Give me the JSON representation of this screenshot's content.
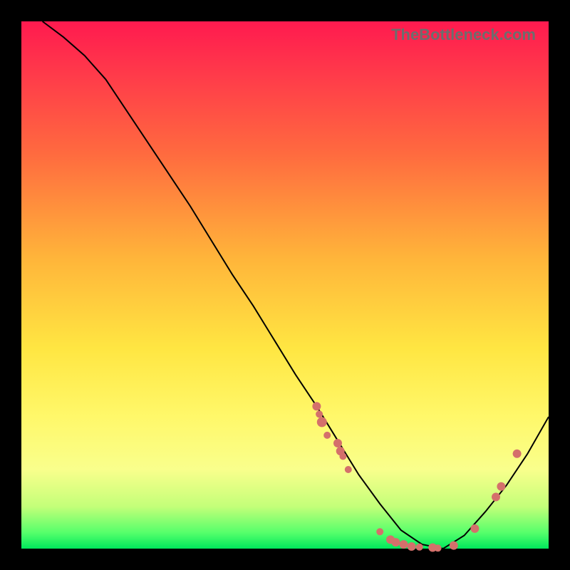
{
  "watermark": "TheBottleneck.com",
  "chart_data": {
    "type": "line",
    "title": "",
    "xlabel": "",
    "ylabel": "",
    "xlim": [
      0,
      100
    ],
    "ylim": [
      0,
      100
    ],
    "grid": false,
    "legend": false,
    "series": [
      {
        "name": "bottleneck-curve",
        "x": [
          4,
          8,
          12,
          16,
          20,
          24,
          28,
          32,
          36,
          40,
          44,
          48,
          52,
          56,
          60,
          64,
          68,
          72,
          76,
          80,
          84,
          88,
          92,
          96,
          100
        ],
        "y": [
          100,
          97,
          93.5,
          89,
          83,
          77,
          71,
          65,
          58.5,
          52,
          46,
          39.5,
          33,
          27,
          20.5,
          14,
          8.5,
          3.5,
          0.8,
          0,
          2.5,
          7,
          12,
          18,
          25
        ],
        "stroke": "#000000",
        "stroke_width": 2
      }
    ],
    "points": [
      {
        "name": "marker",
        "x": 56,
        "y": 27,
        "color": "#d4706b",
        "r": 6
      },
      {
        "name": "marker",
        "x": 56.5,
        "y": 25.5,
        "color": "#d4706b",
        "r": 5
      },
      {
        "name": "marker",
        "x": 57,
        "y": 24,
        "color": "#d4706b",
        "r": 7
      },
      {
        "name": "marker",
        "x": 58,
        "y": 21.5,
        "color": "#d4706b",
        "r": 5
      },
      {
        "name": "marker",
        "x": 60,
        "y": 20,
        "color": "#d4706b",
        "r": 6
      },
      {
        "name": "marker",
        "x": 60.5,
        "y": 18.5,
        "color": "#d4706b",
        "r": 6
      },
      {
        "name": "marker",
        "x": 61,
        "y": 17.5,
        "color": "#d4706b",
        "r": 5
      },
      {
        "name": "marker",
        "x": 62,
        "y": 15,
        "color": "#d4706b",
        "r": 5
      },
      {
        "name": "marker",
        "x": 68,
        "y": 3.2,
        "color": "#d4706b",
        "r": 5
      },
      {
        "name": "marker",
        "x": 70,
        "y": 1.7,
        "color": "#d4706b",
        "r": 6
      },
      {
        "name": "marker",
        "x": 71,
        "y": 1.2,
        "color": "#d4706b",
        "r": 6
      },
      {
        "name": "marker",
        "x": 72.5,
        "y": 0.8,
        "color": "#d4706b",
        "r": 6
      },
      {
        "name": "marker",
        "x": 74,
        "y": 0.4,
        "color": "#d4706b",
        "r": 6
      },
      {
        "name": "marker",
        "x": 75.5,
        "y": 0.3,
        "color": "#d4706b",
        "r": 5
      },
      {
        "name": "marker",
        "x": 78,
        "y": 0.2,
        "color": "#d4706b",
        "r": 6
      },
      {
        "name": "marker",
        "x": 79,
        "y": 0.1,
        "color": "#d4706b",
        "r": 5
      },
      {
        "name": "marker",
        "x": 82,
        "y": 0.6,
        "color": "#d4706b",
        "r": 6
      },
      {
        "name": "marker",
        "x": 86,
        "y": 3.8,
        "color": "#d4706b",
        "r": 6
      },
      {
        "name": "marker",
        "x": 90,
        "y": 9.8,
        "color": "#d4706b",
        "r": 6
      },
      {
        "name": "marker",
        "x": 91,
        "y": 11.8,
        "color": "#d4706b",
        "r": 6
      },
      {
        "name": "marker",
        "x": 94,
        "y": 18,
        "color": "#d4706b",
        "r": 6
      }
    ]
  }
}
